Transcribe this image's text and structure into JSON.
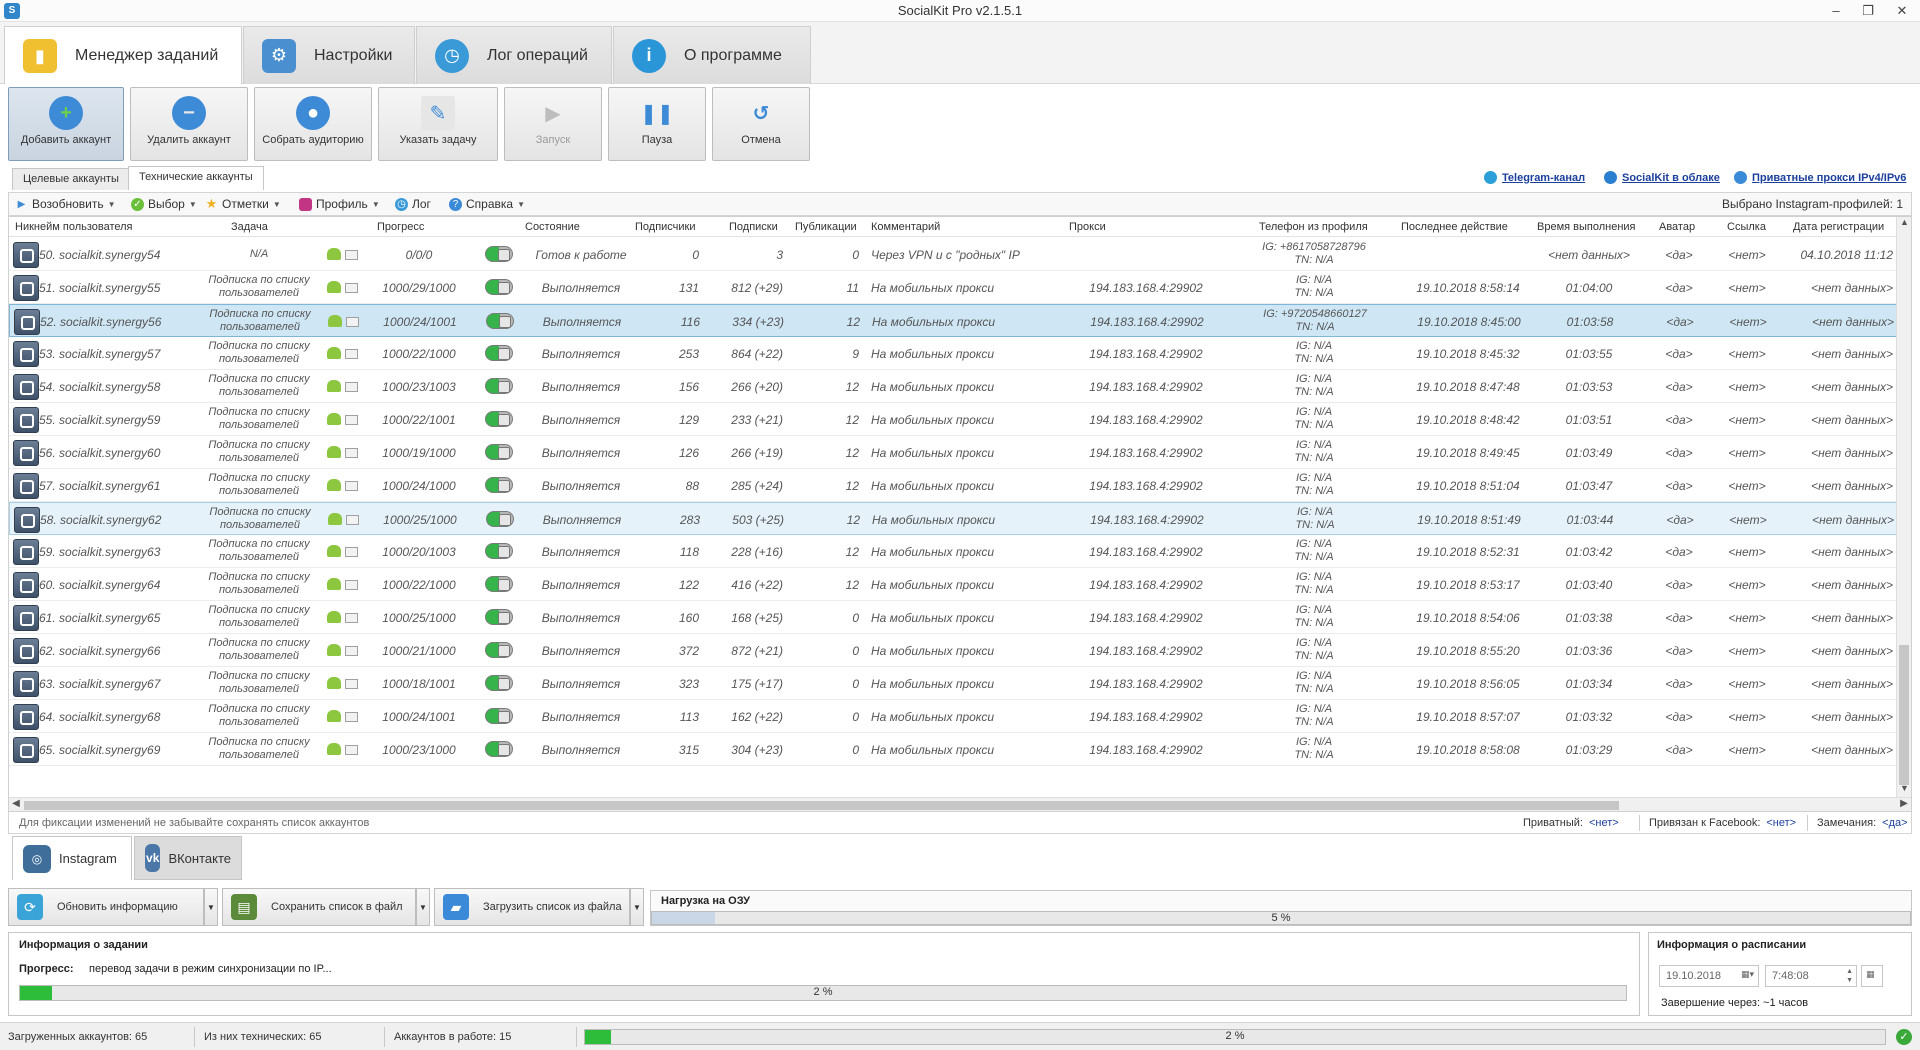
{
  "window": {
    "title": "SocialKit Pro v2.1.5.1",
    "app_icon": "S",
    "minimize": "–",
    "maximize": "❐",
    "close": "✕"
  },
  "main_tabs": [
    {
      "label": "Менеджер заданий",
      "icon": "chart-icon",
      "active": true
    },
    {
      "label": "Настройки",
      "icon": "gears-icon",
      "active": false
    },
    {
      "label": "Лог операций",
      "icon": "clock-icon",
      "active": false
    },
    {
      "label": "О программе",
      "icon": "info-search-icon",
      "active": false
    }
  ],
  "toolbar": [
    {
      "label": "Добавить аккаунт",
      "icon": "add-user-icon"
    },
    {
      "label": "Удалить аккаунт",
      "icon": "remove-user-icon"
    },
    {
      "label": "Собрать аудиторию",
      "icon": "audience-icon"
    },
    {
      "label": "Указать задачу",
      "icon": "task-icon"
    },
    {
      "label": "Запуск",
      "icon": "play-icon"
    },
    {
      "label": "Пауза",
      "icon": "pause-icon"
    },
    {
      "label": "Отмена",
      "icon": "undo-icon"
    }
  ],
  "account_tabs": [
    {
      "label": "Целевые аккаунты",
      "active": false
    },
    {
      "label": "Технические аккаунты",
      "active": true
    }
  ],
  "top_links": [
    {
      "label": "Telegram-канал",
      "icon": "telegram-icon"
    },
    {
      "label": "SocialKit в облаке",
      "icon": "cloud-icon"
    },
    {
      "label": "Приватные прокси IPv4/IPv6",
      "icon": "globe-icon"
    }
  ],
  "filterbar": {
    "items": [
      {
        "label": "Возобновить",
        "icon": "resume-icon"
      },
      {
        "label": "Выбор",
        "icon": "check-icon"
      },
      {
        "label": "Отметки",
        "icon": "star-icon"
      },
      {
        "label": "Профиль",
        "icon": "instagram-icon"
      },
      {
        "label": "Лог",
        "icon": "clock-icon"
      },
      {
        "label": "Справка",
        "icon": "help-icon"
      }
    ],
    "selected_info": "Выбрано Instagram-профилей: 1"
  },
  "grid": {
    "columns": [
      "Никнейм пользователя",
      "Задача",
      "Прогресс",
      "Состояние",
      "Подписчики",
      "Подписки",
      "Публикации",
      "Комментарий",
      "Прокси",
      "Телефон из профиля",
      "Последнее действие",
      "Время выполнения",
      "Аватар",
      "Ссылка",
      "Дата регистрации"
    ],
    "rows": [
      {
        "nick": "50. socialkit.synergy54",
        "task1": "N/A",
        "task2": "",
        "progress": "0/0/0",
        "state": "Готов к работе",
        "followers": "0",
        "following": "3",
        "posts": "0",
        "comment": "Через VPN и с \"родных\" IP",
        "proxy": "",
        "phone1": "IG: +8617058728796",
        "phone2": "TN: N/A",
        "last": "",
        "time": "<нет данных>",
        "avatar": "<да>",
        "link": "<нет>",
        "reg": "04.10.2018 11:12"
      },
      {
        "nick": "51. socialkit.synergy55",
        "task1": "Подписка по списку",
        "task2": "пользователей",
        "progress": "1000/29/1000",
        "state": "Выполняется",
        "followers": "131",
        "following": "812 (+29)",
        "posts": "11",
        "comment": "На мобильных прокси",
        "proxy": "194.183.168.4:29902",
        "phone1": "IG: N/A",
        "phone2": "TN: N/A",
        "last": "19.10.2018 8:58:14",
        "time": "01:04:00",
        "avatar": "<да>",
        "link": "<нет>",
        "reg": "<нет данных>"
      },
      {
        "nick": "52. socialkit.synergy56",
        "task1": "Подписка по списку",
        "task2": "пользователей",
        "progress": "1000/24/1001",
        "state": "Выполняется",
        "followers": "116",
        "following": "334 (+23)",
        "posts": "12",
        "comment": "На мобильных прокси",
        "proxy": "194.183.168.4:29902",
        "phone1": "IG: +9720548660127",
        "phone2": "TN: N/A",
        "last": "19.10.2018 8:45:00",
        "time": "01:03:58",
        "avatar": "<да>",
        "link": "<нет>",
        "reg": "<нет данных>"
      },
      {
        "nick": "53. socialkit.synergy57",
        "task1": "Подписка по списку",
        "task2": "пользователей",
        "progress": "1000/22/1000",
        "state": "Выполняется",
        "followers": "253",
        "following": "864 (+22)",
        "posts": "9",
        "comment": "На мобильных прокси",
        "proxy": "194.183.168.4:29902",
        "phone1": "IG: N/A",
        "phone2": "TN: N/A",
        "last": "19.10.2018 8:45:32",
        "time": "01:03:55",
        "avatar": "<да>",
        "link": "<нет>",
        "reg": "<нет данных>"
      },
      {
        "nick": "54. socialkit.synergy58",
        "task1": "Подписка по списку",
        "task2": "пользователей",
        "progress": "1000/23/1003",
        "state": "Выполняется",
        "followers": "156",
        "following": "266 (+20)",
        "posts": "12",
        "comment": "На мобильных прокси",
        "proxy": "194.183.168.4:29902",
        "phone1": "IG: N/A",
        "phone2": "TN: N/A",
        "last": "19.10.2018 8:47:48",
        "time": "01:03:53",
        "avatar": "<да>",
        "link": "<нет>",
        "reg": "<нет данных>"
      },
      {
        "nick": "55. socialkit.synergy59",
        "task1": "Подписка по списку",
        "task2": "пользователей",
        "progress": "1000/22/1001",
        "state": "Выполняется",
        "followers": "129",
        "following": "233 (+21)",
        "posts": "12",
        "comment": "На мобильных прокси",
        "proxy": "194.183.168.4:29902",
        "phone1": "IG: N/A",
        "phone2": "TN: N/A",
        "last": "19.10.2018 8:48:42",
        "time": "01:03:51",
        "avatar": "<да>",
        "link": "<нет>",
        "reg": "<нет данных>"
      },
      {
        "nick": "56. socialkit.synergy60",
        "task1": "Подписка по списку",
        "task2": "пользователей",
        "progress": "1000/19/1000",
        "state": "Выполняется",
        "followers": "126",
        "following": "266 (+19)",
        "posts": "12",
        "comment": "На мобильных прокси",
        "proxy": "194.183.168.4:29902",
        "phone1": "IG: N/A",
        "phone2": "TN: N/A",
        "last": "19.10.2018 8:49:45",
        "time": "01:03:49",
        "avatar": "<да>",
        "link": "<нет>",
        "reg": "<нет данных>"
      },
      {
        "nick": "57. socialkit.synergy61",
        "task1": "Подписка по списку",
        "task2": "пользователей",
        "progress": "1000/24/1000",
        "state": "Выполняется",
        "followers": "88",
        "following": "285 (+24)",
        "posts": "12",
        "comment": "На мобильных прокси",
        "proxy": "194.183.168.4:29902",
        "phone1": "IG: N/A",
        "phone2": "TN: N/A",
        "last": "19.10.2018 8:51:04",
        "time": "01:03:47",
        "avatar": "<да>",
        "link": "<нет>",
        "reg": "<нет данных>"
      },
      {
        "nick": "58. socialkit.synergy62",
        "task1": "Подписка по списку",
        "task2": "пользователей",
        "progress": "1000/25/1000",
        "state": "Выполняется",
        "followers": "283",
        "following": "503 (+25)",
        "posts": "12",
        "comment": "На мобильных прокси",
        "proxy": "194.183.168.4:29902",
        "phone1": "IG: N/A",
        "phone2": "TN: N/A",
        "last": "19.10.2018 8:51:49",
        "time": "01:03:44",
        "avatar": "<да>",
        "link": "<нет>",
        "reg": "<нет данных>"
      },
      {
        "nick": "59. socialkit.synergy63",
        "task1": "Подписка по списку",
        "task2": "пользователей",
        "progress": "1000/20/1003",
        "state": "Выполняется",
        "followers": "118",
        "following": "228 (+16)",
        "posts": "12",
        "comment": "На мобильных прокси",
        "proxy": "194.183.168.4:29902",
        "phone1": "IG: N/A",
        "phone2": "TN: N/A",
        "last": "19.10.2018 8:52:31",
        "time": "01:03:42",
        "avatar": "<да>",
        "link": "<нет>",
        "reg": "<нет данных>"
      },
      {
        "nick": "60. socialkit.synergy64",
        "task1": "Подписка по списку",
        "task2": "пользователей",
        "progress": "1000/22/1000",
        "state": "Выполняется",
        "followers": "122",
        "following": "416 (+22)",
        "posts": "12",
        "comment": "На мобильных прокси",
        "proxy": "194.183.168.4:29902",
        "phone1": "IG: N/A",
        "phone2": "TN: N/A",
        "last": "19.10.2018 8:53:17",
        "time": "01:03:40",
        "avatar": "<да>",
        "link": "<нет>",
        "reg": "<нет данных>"
      },
      {
        "nick": "61. socialkit.synergy65",
        "task1": "Подписка по списку",
        "task2": "пользователей",
        "progress": "1000/25/1000",
        "state": "Выполняется",
        "followers": "160",
        "following": "168 (+25)",
        "posts": "0",
        "comment": "На мобильных прокси",
        "proxy": "194.183.168.4:29902",
        "phone1": "IG: N/A",
        "phone2": "TN: N/A",
        "last": "19.10.2018 8:54:06",
        "time": "01:03:38",
        "avatar": "<да>",
        "link": "<нет>",
        "reg": "<нет данных>"
      },
      {
        "nick": "62. socialkit.synergy66",
        "task1": "Подписка по списку",
        "task2": "пользователей",
        "progress": "1000/21/1000",
        "state": "Выполняется",
        "followers": "372",
        "following": "872 (+21)",
        "posts": "0",
        "comment": "На мобильных прокси",
        "proxy": "194.183.168.4:29902",
        "phone1": "IG: N/A",
        "phone2": "TN: N/A",
        "last": "19.10.2018 8:55:20",
        "time": "01:03:36",
        "avatar": "<да>",
        "link": "<нет>",
        "reg": "<нет данных>"
      },
      {
        "nick": "63. socialkit.synergy67",
        "task1": "Подписка по списку",
        "task2": "пользователей",
        "progress": "1000/18/1001",
        "state": "Выполняется",
        "followers": "323",
        "following": "175 (+17)",
        "posts": "0",
        "comment": "На мобильных прокси",
        "proxy": "194.183.168.4:29902",
        "phone1": "IG: N/A",
        "phone2": "TN: N/A",
        "last": "19.10.2018 8:56:05",
        "time": "01:03:34",
        "avatar": "<да>",
        "link": "<нет>",
        "reg": "<нет данных>"
      },
      {
        "nick": "64. socialkit.synergy68",
        "task1": "Подписка по списку",
        "task2": "пользователей",
        "progress": "1000/24/1001",
        "state": "Выполняется",
        "followers": "113",
        "following": "162 (+22)",
        "posts": "0",
        "comment": "На мобильных прокси",
        "proxy": "194.183.168.4:29902",
        "phone1": "IG: N/A",
        "phone2": "TN: N/A",
        "last": "19.10.2018 8:57:07",
        "time": "01:03:32",
        "avatar": "<да>",
        "link": "<нет>",
        "reg": "<нет данных>"
      },
      {
        "nick": "65. socialkit.synergy69",
        "task1": "Подписка по списку",
        "task2": "пользователей",
        "progress": "1000/23/1000",
        "state": "Выполняется",
        "followers": "315",
        "following": "304 (+23)",
        "posts": "0",
        "comment": "На мобильных прокси",
        "proxy": "194.183.168.4:29902",
        "phone1": "IG: N/A",
        "phone2": "TN: N/A",
        "last": "19.10.2018 8:58:08",
        "time": "01:03:29",
        "avatar": "<да>",
        "link": "<нет>",
        "reg": "<нет данных>"
      }
    ]
  },
  "infobar": {
    "hint": "Для фиксации изменений не забывайте сохранять список аккаунтов",
    "private_label": "Приватный:",
    "private_value": "<нет>",
    "facebook_label": "Привязан к Facebook:",
    "facebook_value": "<нет>",
    "notes_label": "Замечания:",
    "notes_value": "<да>"
  },
  "social_tabs": [
    {
      "label": "Instagram",
      "icon": "instagram-icon",
      "active": true
    },
    {
      "label": "ВКонтакте",
      "icon": "vk-icon",
      "active": false
    }
  ],
  "actions": {
    "refresh": "Обновить информацию",
    "save": "Сохранить список в файл",
    "load": "Загрузить список из файла"
  },
  "ram": {
    "title": "Нагрузка на ОЗУ",
    "value": 5,
    "text": "5 %"
  },
  "task_info": {
    "title": "Информация о задании",
    "progress_label": "Прогресс:",
    "progress_text": "перевод задачи в режим синхронизации по IP...",
    "value": 2,
    "percent_text": "2 %"
  },
  "schedule": {
    "title": "Информация о расписании",
    "date": "19.10.2018",
    "time": "7:48:08",
    "finish": "Завершение через: ~1 часов"
  },
  "statusbar": {
    "loaded": "Загруженных аккаунтов: 65",
    "technical": "Из них технических: 65",
    "working": "Аккаунтов в работе: 15",
    "value": 2,
    "percent_text": "2 %"
  },
  "colors": {
    "accent_blue": "#2f86c8",
    "selected_row": "#cfe6f4",
    "progress_green": "#2ebd3a",
    "link_blue": "#1b3f9c"
  }
}
